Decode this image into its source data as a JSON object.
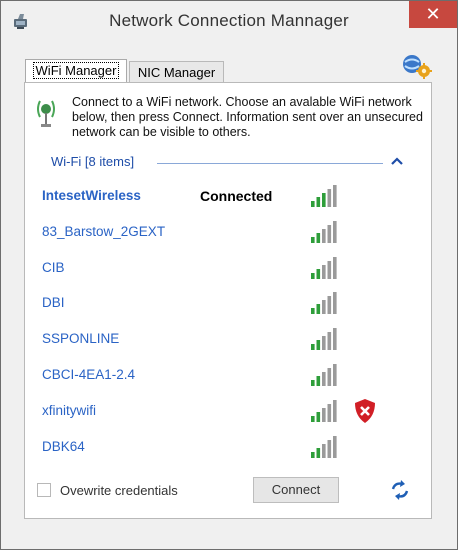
{
  "window": {
    "title": "Network Connection Mannager",
    "close_glyph": "✕"
  },
  "tabs": [
    {
      "label": "WiFi Manager",
      "selected": true
    },
    {
      "label": "NIC Manager",
      "selected": false
    }
  ],
  "info": {
    "text": "Connect to a WiFi network. Choose an avalable WiFi network below, then press Connect. Information sent over an unsecured network can be visible to others.",
    "icon": "wifi-antenna-icon"
  },
  "group": {
    "label": "Wi-Fi [8 items]",
    "collapse_icon": "chevron-up-icon"
  },
  "networks": [
    {
      "name": "IntesetWireless",
      "status": "Connected",
      "signal_bars": 5,
      "secure_warning": false
    },
    {
      "name": "83_Barstow_2GEXT",
      "status": "",
      "signal_bars": 5,
      "secure_warning": false
    },
    {
      "name": "CIB",
      "status": "",
      "signal_bars": 5,
      "secure_warning": false
    },
    {
      "name": "DBI",
      "status": "",
      "signal_bars": 5,
      "secure_warning": false
    },
    {
      "name": "SSPONLINE",
      "status": "",
      "signal_bars": 5,
      "secure_warning": false
    },
    {
      "name": "CBCI-4EA1-2.4",
      "status": "",
      "signal_bars": 5,
      "secure_warning": false
    },
    {
      "name": "xfinitywifi",
      "status": "",
      "signal_bars": 5,
      "secure_warning": true
    },
    {
      "name": "DBK64",
      "status": "",
      "signal_bars": 5,
      "secure_warning": false
    }
  ],
  "footer": {
    "checkbox_label": "Ovewrite credentials",
    "checkbox_checked": false,
    "connect_label": "Connect"
  },
  "colors": {
    "accent_link": "#2a63c5",
    "close_button": "#c7483f",
    "signal_bar_active": "#2e9e3a",
    "signal_bar_inactive": "#9a9a9a",
    "warning_shield": "#d11f26"
  }
}
